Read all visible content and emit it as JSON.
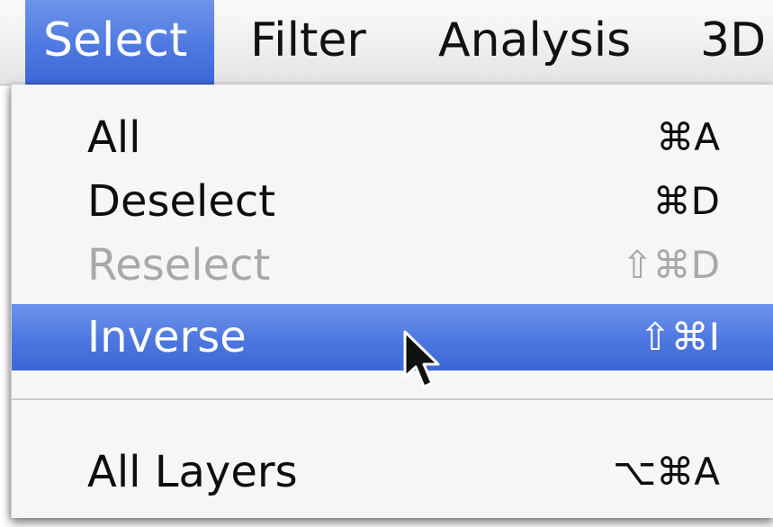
{
  "menubar": {
    "titles": [
      "Select",
      "Filter",
      "Analysis",
      "3D"
    ],
    "active": "Select"
  },
  "dropdown": {
    "items": [
      {
        "label": "All",
        "shortcut": "⌘A",
        "state": "normal"
      },
      {
        "label": "Deselect",
        "shortcut": "⌘D",
        "state": "normal"
      },
      {
        "label": "Reselect",
        "shortcut": "⇧⌘D",
        "state": "disabled"
      },
      {
        "label": "Inverse",
        "shortcut": "⇧⌘I",
        "state": "highlighted"
      },
      {
        "label": "All Layers",
        "shortcut": "⌥⌘A",
        "state": "normal"
      }
    ]
  },
  "colors": {
    "highlight": "#4d77df",
    "menu_background": "#f6f6f6",
    "disabled_text": "#a8a8a8"
  },
  "icons": {
    "cursor": "arrow-cursor-icon"
  }
}
